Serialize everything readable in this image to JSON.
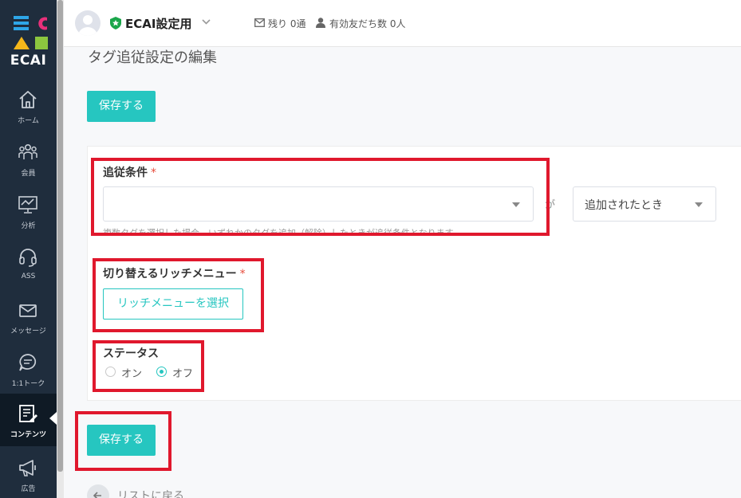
{
  "sidebar": {
    "logo_text": "ECAI",
    "items": [
      {
        "label": "ホーム",
        "icon": "home-icon"
      },
      {
        "label": "会員",
        "icon": "members-icon"
      },
      {
        "label": "分析",
        "icon": "analytics-icon"
      },
      {
        "label": "ASS",
        "icon": "headset-icon"
      },
      {
        "label": "メッセージ",
        "icon": "message-icon"
      },
      {
        "label": "1:1トーク",
        "icon": "chat-icon"
      },
      {
        "label": "コンテンツ",
        "icon": "content-icon",
        "active": true
      },
      {
        "label": "広告",
        "icon": "megaphone-icon"
      }
    ]
  },
  "header": {
    "account_name": "ECAI設定用",
    "remaining": "残り 0通",
    "friends": "有効友だち数 0人"
  },
  "page": {
    "title": "タグ追従設定の編集",
    "save_label": "保存する",
    "back_label": "リストに戻る"
  },
  "form": {
    "condition_label": "追従条件",
    "required_mark": "*",
    "condition_value": "",
    "ga": "が",
    "trigger_value": "追加されたとき",
    "hint": "複数タグを選択した場合、いずれかのタグを追加（解除）したときが追従条件となります",
    "richmenu_label": "切り替えるリッチメニュー",
    "richmenu_button": "リッチメニューを選択",
    "status_label": "ステータス",
    "status_on": "オン",
    "status_off": "オフ",
    "status_selected": "オフ"
  },
  "colors": {
    "accent": "#26c6c0",
    "sidebar": "#1f2d3d",
    "annotation": "#e0182d"
  }
}
